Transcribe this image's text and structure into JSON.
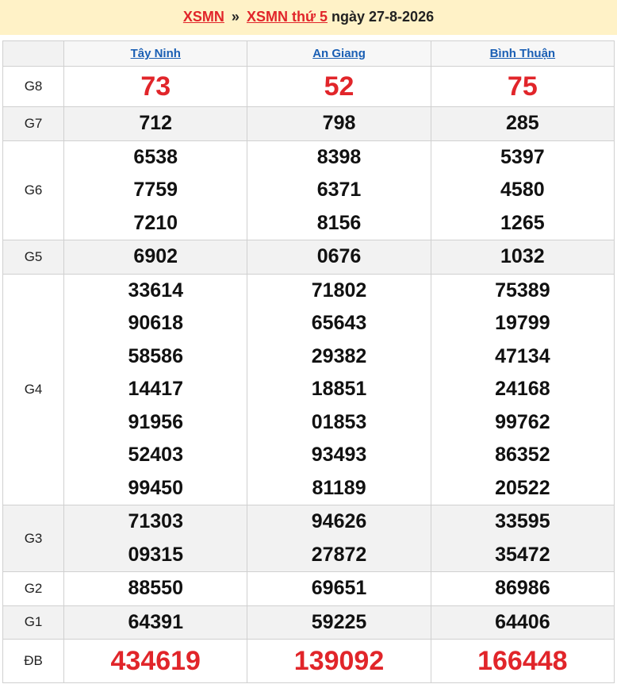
{
  "breadcrumb": {
    "link1": "XSMN",
    "separator": "»",
    "link2": "XSMN thứ 5",
    "date_text": "ngày 27-8-2026"
  },
  "provinces": [
    "Tây Ninh",
    "An Giang",
    "Bình Thuận"
  ],
  "colors": {
    "accent_red": "#e1252a",
    "link_blue": "#1a5fb4",
    "header_bg": "#fff2c7"
  },
  "prizes": [
    {
      "label": "G8",
      "values": [
        [
          "73"
        ],
        [
          "52"
        ],
        [
          "75"
        ]
      ]
    },
    {
      "label": "G7",
      "values": [
        [
          "712"
        ],
        [
          "798"
        ],
        [
          "285"
        ]
      ]
    },
    {
      "label": "G6",
      "values": [
        [
          "6538",
          "7759",
          "7210"
        ],
        [
          "8398",
          "6371",
          "8156"
        ],
        [
          "5397",
          "4580",
          "1265"
        ]
      ]
    },
    {
      "label": "G5",
      "values": [
        [
          "6902"
        ],
        [
          "0676"
        ],
        [
          "1032"
        ]
      ]
    },
    {
      "label": "G4",
      "values": [
        [
          "33614",
          "90618",
          "58586",
          "14417",
          "91956",
          "52403",
          "99450"
        ],
        [
          "71802",
          "65643",
          "29382",
          "18851",
          "01853",
          "93493",
          "81189"
        ],
        [
          "75389",
          "19799",
          "47134",
          "24168",
          "99762",
          "86352",
          "20522"
        ]
      ]
    },
    {
      "label": "G3",
      "values": [
        [
          "71303",
          "09315"
        ],
        [
          "94626",
          "27872"
        ],
        [
          "33595",
          "35472"
        ]
      ]
    },
    {
      "label": "G2",
      "values": [
        [
          "88550"
        ],
        [
          "69651"
        ],
        [
          "86986"
        ]
      ]
    },
    {
      "label": "G1",
      "values": [
        [
          "64391"
        ],
        [
          "59225"
        ],
        [
          "64406"
        ]
      ]
    },
    {
      "label": "ĐB",
      "values": [
        [
          "434619"
        ],
        [
          "139092"
        ],
        [
          "166448"
        ]
      ]
    }
  ]
}
